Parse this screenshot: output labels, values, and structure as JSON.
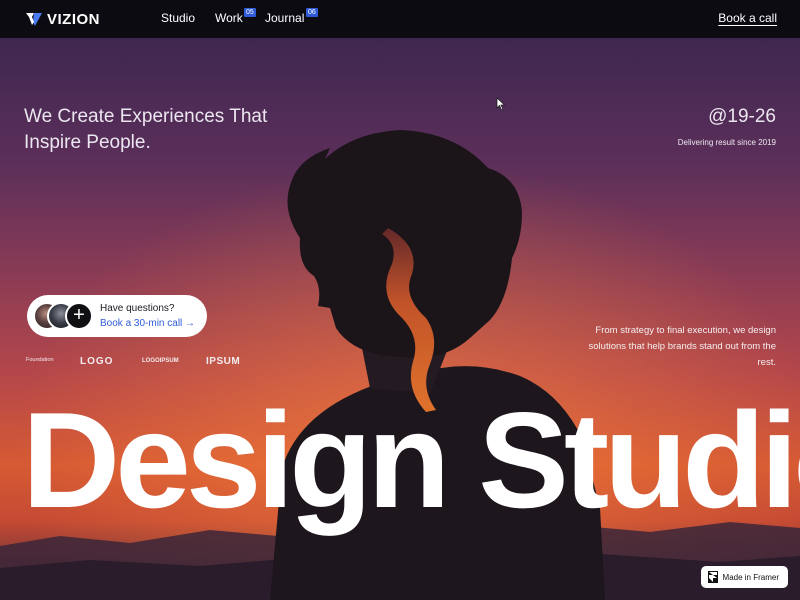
{
  "nav": {
    "logo": "VIZION",
    "links": [
      {
        "label": "Studio"
      },
      {
        "label": "Work",
        "badge": "05"
      },
      {
        "label": "Journal",
        "badge": "06"
      }
    ],
    "cta": "Book a call"
  },
  "hero": {
    "tagline": "We Create Experiences That Inspire People.",
    "years": "@19-26",
    "delivering": "Delivering result since 2019",
    "question": {
      "title": "Have questions?",
      "link": "Book a 30-min call"
    },
    "brands": [
      "Foundation",
      "LOGO",
      "LOGOIPSUM",
      "IPSUM"
    ],
    "strategy": "From strategy to final execution, we design solutions that help brands stand out from the rest.",
    "title": "Design Studio",
    "badge": "Made in Framer"
  },
  "colors": {
    "accent": "#2f5bd8",
    "nav_background": "#0c0b12",
    "sky_top": "#3e2750",
    "sky_bottom": "#d65a33"
  }
}
